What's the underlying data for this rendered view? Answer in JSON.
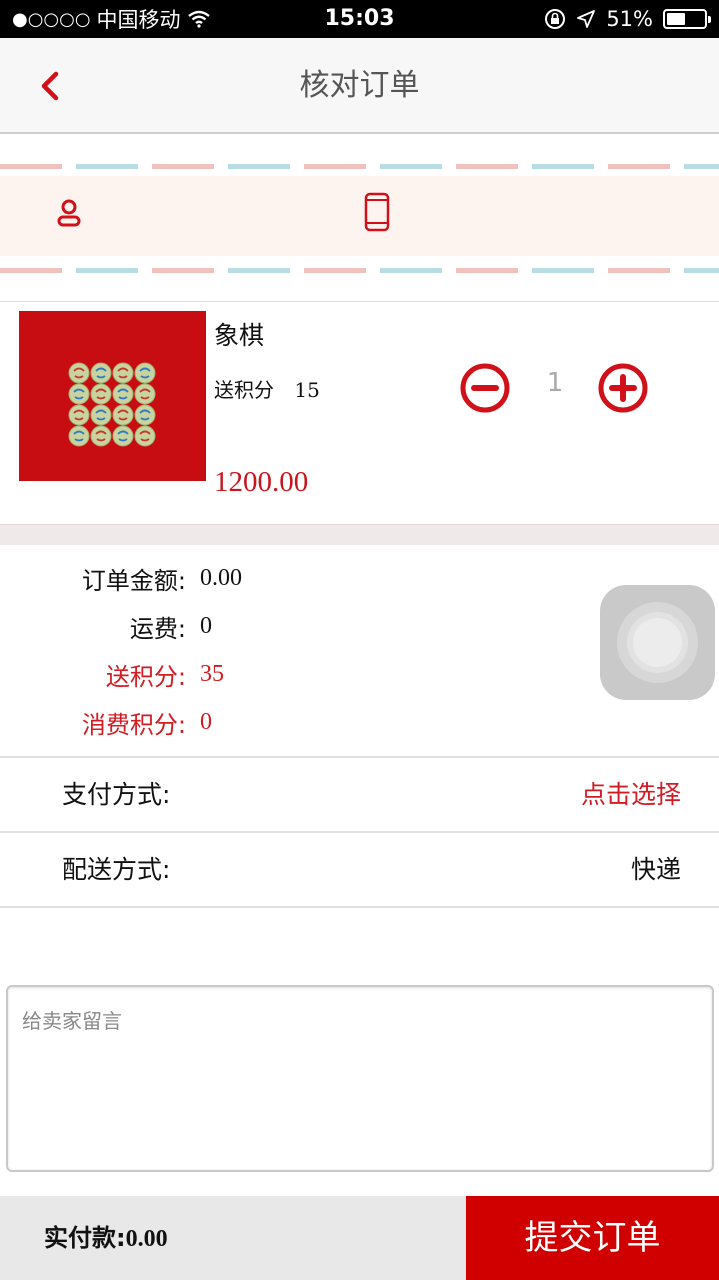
{
  "status_bar": {
    "signal": "●○○○○",
    "carrier": "中国移动",
    "time": "15:03",
    "battery_percent": "51%",
    "battery_level": 0.51
  },
  "nav": {
    "title": "核对订单"
  },
  "product": {
    "name": "象棋",
    "bonus_label": "送积分",
    "bonus_value": "15",
    "price": "1200.00",
    "quantity": "1"
  },
  "summary": {
    "order_amount_label": "订单金额:",
    "order_amount_value": "0.00",
    "shipping_label": "运费:",
    "shipping_value": "0",
    "bonus_points_label": "送积分:",
    "bonus_points_value": "35",
    "spend_points_label": "消费积分:",
    "spend_points_value": "0"
  },
  "payment": {
    "label": "支付方式:",
    "value": "点击选择"
  },
  "delivery": {
    "label": "配送方式:",
    "value": "快递"
  },
  "message": {
    "placeholder": "给卖家留言"
  },
  "footer": {
    "pay_label": "实付款:",
    "pay_value": "0.00",
    "submit_label": "提交订单"
  },
  "colors": {
    "accent_red": "#d00000",
    "price_red": "#c8161e"
  }
}
